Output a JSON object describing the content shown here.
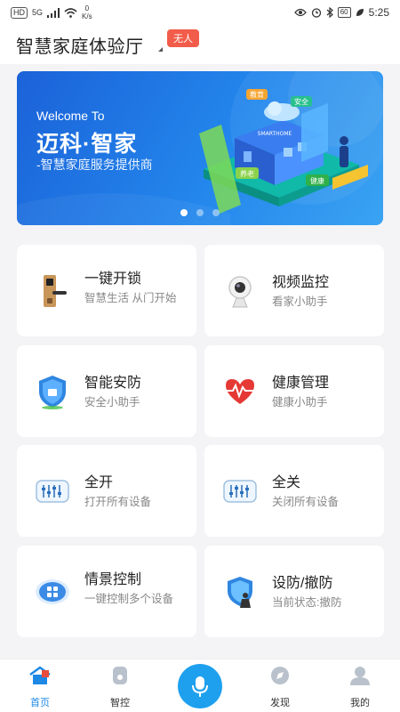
{
  "status_bar": {
    "left_chip": "HD",
    "net_type": "5G",
    "speed_value": "0",
    "speed_unit": "K/s",
    "battery": "60",
    "time": "5:25"
  },
  "header": {
    "title": "智慧家庭体验厅",
    "badge": "无人"
  },
  "banner": {
    "welcome": "Welcome To",
    "brand": "迈科·智家",
    "subtitle": "-智慧家庭服务提供商",
    "art_labels": [
      "教育",
      "安全",
      "SMARTHOME",
      "养老",
      "健康"
    ],
    "slide_count": 3,
    "active_slide": 1
  },
  "cards": [
    {
      "title": "一键开锁",
      "subtitle": "智慧生活 从门开始",
      "icon": "door-lock-icon"
    },
    {
      "title": "视频监控",
      "subtitle": "看家小助手",
      "icon": "camera-icon"
    },
    {
      "title": "智能安防",
      "subtitle": "安全小助手",
      "icon": "shield-icon"
    },
    {
      "title": "健康管理",
      "subtitle": "健康小助手",
      "icon": "heart-pulse-icon"
    },
    {
      "title": "全开",
      "subtitle": "打开所有设备",
      "icon": "switch-panel-icon"
    },
    {
      "title": "全关",
      "subtitle": "关闭所有设备",
      "icon": "switch-panel-icon"
    },
    {
      "title": "情景控制",
      "subtitle": "一键控制多个设备",
      "icon": "scene-panel-icon"
    },
    {
      "title": "设防/撤防",
      "subtitle": "当前状态:撤防",
      "icon": "arm-disarm-icon"
    }
  ],
  "nav": [
    {
      "label": "首页",
      "icon": "home-icon",
      "active": true
    },
    {
      "label": "智控",
      "icon": "control-icon"
    },
    {
      "label": "",
      "icon": "mic-icon"
    },
    {
      "label": "发现",
      "icon": "discover-icon"
    },
    {
      "label": "我的",
      "icon": "profile-icon"
    }
  ],
  "colors": {
    "accent": "#1e88e5",
    "badge": "#f25c4a",
    "banner_start": "#1b62d8",
    "banner_end": "#3aa3f2",
    "mic": "#1ea0ee"
  }
}
